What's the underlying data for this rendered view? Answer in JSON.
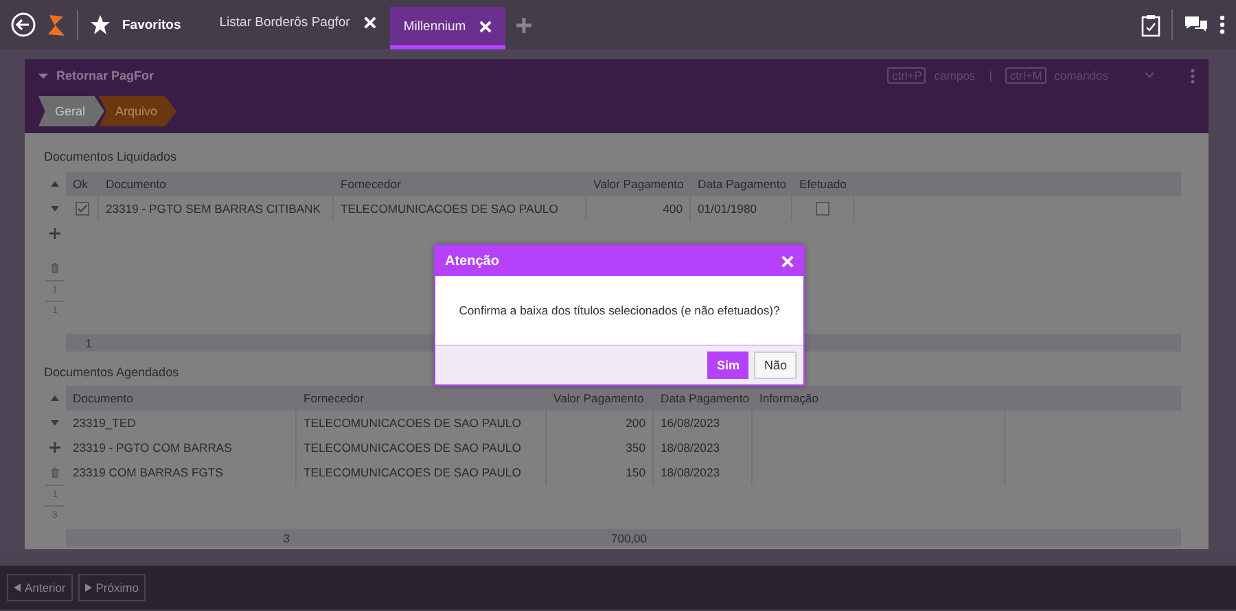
{
  "topbar": {
    "favorites": "Favoritos",
    "tabs": [
      {
        "label": "Listar Borderôs Pagfor",
        "selected": false
      },
      {
        "label": "Millennium",
        "selected": true
      }
    ]
  },
  "panel": {
    "title": "Retornar PagFor",
    "shortcuts": [
      {
        "key": "ctrl+P",
        "label": "campos"
      },
      {
        "key": "ctrl+M",
        "label": "comandos"
      }
    ],
    "separator": "|",
    "steps": [
      {
        "label": "Geral",
        "selected": false
      },
      {
        "label": "Arquivo",
        "selected": true
      }
    ]
  },
  "liquidados": {
    "title": "Documentos Liquidados",
    "columns": [
      "Ok",
      "Documento",
      "Fornecedor",
      "Valor Pagamento",
      "Data Pagamento",
      "Efetuado"
    ],
    "rows": [
      {
        "ok": true,
        "documento": "23319 - PGTO SEM BARRAS CITIBANK",
        "fornecedor": "TELECOMUNICACOES DE SAO PAULO",
        "valor": "400",
        "data": "01/01/1980",
        "efetuado": false
      }
    ],
    "row_numbers": [
      "1",
      "1"
    ],
    "footer_count": "1"
  },
  "agendados": {
    "title": "Documentos Agendados",
    "columns": [
      "Documento",
      "Fornecedor",
      "Valor Pagamento",
      "Data Pagamento",
      "Informação"
    ],
    "rows": [
      {
        "documento": "23319_TED",
        "fornecedor": "TELECOMUNICACOES DE SAO PAULO",
        "valor": "200",
        "data": "16/08/2023"
      },
      {
        "documento": "23319 - PGTO COM BARRAS",
        "fornecedor": "TELECOMUNICACOES DE SAO PAULO",
        "valor": "350",
        "data": "18/08/2023"
      },
      {
        "documento": "23319 COM BARRAS FGTS",
        "fornecedor": "TELECOMUNICACOES DE SAO PAULO",
        "valor": "150",
        "data": "18/08/2023"
      }
    ],
    "row_numbers": [
      "1",
      "3"
    ],
    "footer_count": "3",
    "footer_total": "700,00"
  },
  "dialog": {
    "title": "Atenção",
    "message": "Confirma a baixa dos títulos selecionados (e não efetuados)?",
    "buttons": [
      {
        "label": "Sim",
        "kind": "primary"
      },
      {
        "label": "Não",
        "kind": "secondary"
      }
    ]
  },
  "nav": [
    {
      "label": "Anterior",
      "kind": "previous"
    },
    {
      "label": "Próximo",
      "kind": "next"
    }
  ]
}
